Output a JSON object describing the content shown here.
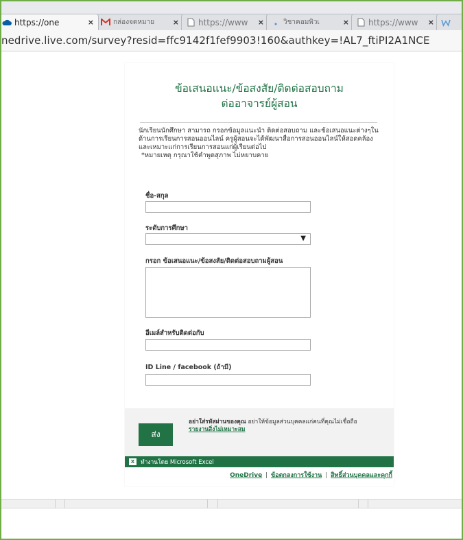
{
  "browser": {
    "tabs": [
      {
        "label": "https://one",
        "icon": "onedrive-cloud-icon",
        "close": "×"
      },
      {
        "label": "กล่องจดหมาย",
        "icon": "gmail-icon",
        "close": "×"
      },
      {
        "label": "https://www",
        "icon": "document-icon",
        "close": "×"
      },
      {
        "label": "วิชาคอมพิวเ",
        "icon": "loading-dot-icon",
        "close": "×"
      },
      {
        "label": "https://www",
        "icon": "document-icon",
        "close": "×"
      },
      {
        "label": "",
        "icon": "word-icon",
        "close": ""
      }
    ],
    "url": "nedrive.live.com/survey?resid=ffc9142f1fef9903!160&authkey=!AL7_ftiPI2A1NCE"
  },
  "survey": {
    "title_line1": "ข้อเสนอแนะ/ข้อสงสัย/ติดต่อสอบถาม",
    "title_line2": "ต่ออาจารย์ผู้สอน",
    "description": "นักเรียนนักศึกษา สามารถ กรอกข้อมูลแนะนำ ติดต่อสอบถาม และข้อเสนอแนะต่างๆในด้านการเรียนการสอนออนไลน์ ครูผู้สอนจะได้พัฒนาสื่อการสอนออนไลน์ให้สอดคล้องและเหมาะแก่การเรียนการสอนแก่ผู้เรียนต่อไป",
    "note": "*หมายเหตุ กรุณาใช้คำพูดสุภาพ ไม่หยาบคาย",
    "questions": {
      "name_label": "ชื่อ-สกุล",
      "level_label": "ระดับการศึกษา",
      "message_label": "กรอก ข้อเสนอแนะ/ข้อสงสัย/ติดต่อสอบถามผู้สอน",
      "email_label": "อีเมล์สำหรับติดต่อกับ",
      "line_label": "ID Line / facebook (ถ้ามี)"
    },
    "select_arrow": "▼",
    "submit_label": "ส่ง",
    "warning_bold": "อย่าใส่รหัสผ่านของคุณ",
    "warning_text": "อย่าให้ข้อมูลส่วนบุคคลแก่คนที่คุณไม่เชื่อถือ",
    "report_link": "รายงานสิ่งไม่เหมาะสม",
    "excel_logo": "X",
    "powered_by": "ทำงานโดย Microsoft Excel",
    "footer": {
      "onedrive": "OneDrive",
      "terms": "ข้อตกลงการใช้งาน",
      "privacy": "สิทธิ์ส่วนบุคคลและคุกกี้",
      "separator": "|"
    }
  },
  "colors": {
    "accent_green": "#217346",
    "frame_green": "#70ad47"
  }
}
